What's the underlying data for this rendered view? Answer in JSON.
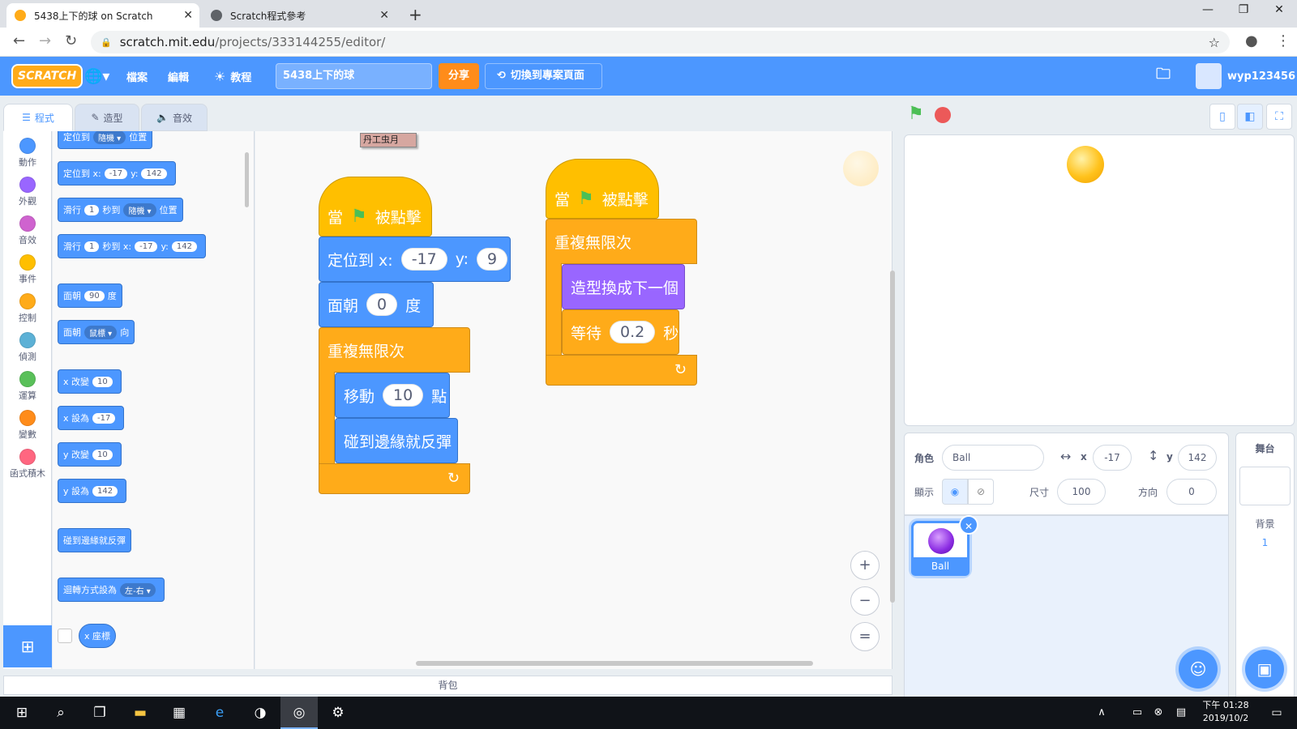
{
  "browser": {
    "tabs": [
      {
        "title": "5438上下的球 on Scratch",
        "active": true
      },
      {
        "title": "Scratch程式參考",
        "active": false
      }
    ],
    "url_host": "scratch.mit.edu",
    "url_path": "/projects/333144255/editor/"
  },
  "menu": {
    "logo": "SCRATCH",
    "file": "檔案",
    "edit": "編輯",
    "tutorials": "教程",
    "project_title": "5438上下的球",
    "share": "分享",
    "see_project_page": "切換到專案頁面",
    "username": "wyp123456"
  },
  "editor_tabs": {
    "code": "程式",
    "costumes": "造型",
    "sounds": "音效"
  },
  "categories": [
    {
      "label": "動作",
      "color": "#4c97ff"
    },
    {
      "label": "外觀",
      "color": "#9966ff"
    },
    {
      "label": "音效",
      "color": "#cf63cf"
    },
    {
      "label": "事件",
      "color": "#ffbf00"
    },
    {
      "label": "控制",
      "color": "#ffab19"
    },
    {
      "label": "偵測",
      "color": "#5cb1d6"
    },
    {
      "label": "運算",
      "color": "#59c059"
    },
    {
      "label": "變數",
      "color": "#ff8c1a"
    },
    {
      "label": "函式積木",
      "color": "#ff6680"
    }
  ],
  "palette": {
    "goto_random": {
      "pre": "定位到",
      "dd": "隨機 ▾",
      "post": "位置"
    },
    "goto_xy": {
      "pre": "定位到 x:",
      "x": "-17",
      "ylabel": "y:",
      "y": "142"
    },
    "glide_random": {
      "pre": "滑行",
      "secs": "1",
      "mid": "秒到",
      "dd": "隨機 ▾",
      "post": "位置"
    },
    "glide_xy": {
      "pre": "滑行",
      "secs": "1",
      "mid": "秒到 x:",
      "x": "-17",
      "ylabel": "y:",
      "y": "142"
    },
    "point_dir": {
      "pre": "面朝",
      "val": "90",
      "post": "度"
    },
    "point_towards": {
      "pre": "面朝",
      "dd": "鼠標 ▾",
      "post": "向"
    },
    "change_x": {
      "pre": "x 改變",
      "val": "10"
    },
    "set_x": {
      "pre": "x 設為",
      "val": "-17"
    },
    "change_y": {
      "pre": "y 改變",
      "val": "10"
    },
    "set_y": {
      "pre": "y 設為",
      "val": "142"
    },
    "bounce": "碰到邊緣就反彈",
    "rotation": {
      "pre": "迴轉方式設為",
      "dd": "左-右 ▾"
    },
    "x_position": "x 座標"
  },
  "workspace": {
    "comment": "丹工虫月",
    "script1": {
      "hat_pre": "當",
      "hat_post": "被點擊",
      "goto_pre": "定位到 x:",
      "goto_x": "-17",
      "goto_ylabel": "y:",
      "goto_y": "9",
      "point_pre": "面朝",
      "point_val": "0",
      "point_post": "度",
      "forever": "重複無限次",
      "move_pre": "移動",
      "move_val": "10",
      "move_post": "點",
      "bounce": "碰到邊緣就反彈"
    },
    "script2": {
      "hat_pre": "當",
      "hat_post": "被點擊",
      "forever": "重複無限次",
      "next_costume": "造型換成下一個",
      "wait_pre": "等待",
      "wait_val": "0.2",
      "wait_post": "秒"
    },
    "zoom_in": "+",
    "zoom_out": "−",
    "zoom_reset": "="
  },
  "backpack": "背包",
  "sprite_info": {
    "sprite_label": "角色",
    "sprite_name": "Ball",
    "x_label": "x",
    "x_val": "-17",
    "y_label": "y",
    "y_val": "142",
    "show_label": "顯示",
    "size_label": "尺寸",
    "size_val": "100",
    "direction_label": "方向",
    "direction_val": "0"
  },
  "sprites": [
    {
      "name": "Ball",
      "color": "#8a2be2",
      "selected": true
    }
  ],
  "stage_panel": {
    "title": "舞台",
    "backdrops_label": "背景",
    "backdrops_count": "1"
  },
  "taskbar": {
    "time": "下午 01:28",
    "date": "2019/10/2"
  }
}
